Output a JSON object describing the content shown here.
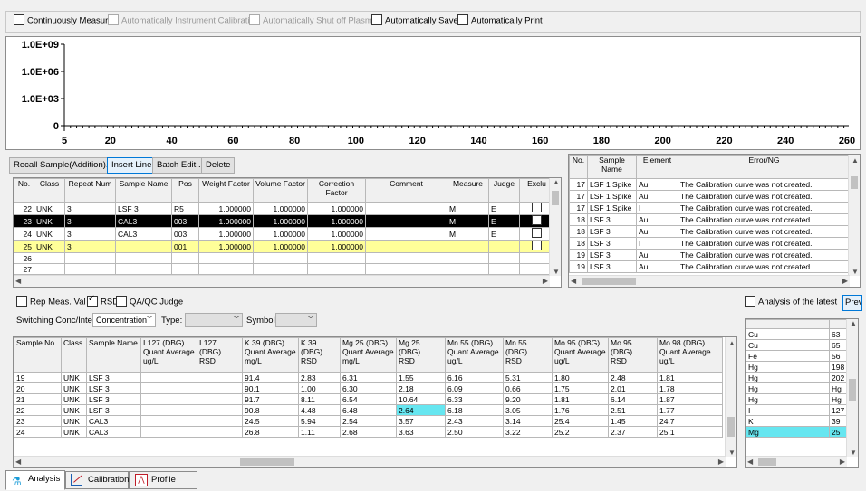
{
  "options": {
    "continuously_measure": "Continuously Measure",
    "auto_calibration": "Automatically Instrument Calibration",
    "auto_shutoff": "Automatically Shut off Plasma",
    "auto_save": "Automatically Save",
    "auto_print": "Automatically Print"
  },
  "graph": {
    "y_ticks": [
      "1.0E+09",
      "1.0E+06",
      "1.0E+03",
      "0"
    ],
    "x_ticks": [
      "5",
      "20",
      "40",
      "60",
      "80",
      "100",
      "120",
      "140",
      "160",
      "180",
      "200",
      "220",
      "240",
      "260"
    ]
  },
  "toolbar": {
    "recall": "Recall Sample(Addition)...",
    "insert": "Insert Line",
    "batch": "Batch Edit...",
    "delete": "Delete"
  },
  "sample_table": {
    "headers": [
      "No.",
      "Class",
      "Repeat Num",
      "Sample Name",
      "Pos",
      "Weight Factor",
      "Volume Factor",
      "Correction Factor",
      "Comment",
      "Measure",
      "Judge",
      "Exclu"
    ],
    "rows": [
      [
        "22",
        "UNK",
        "3",
        "LSF 3",
        "R5",
        "1.000000",
        "1.000000",
        "1.000000",
        "",
        "M",
        "E"
      ],
      [
        "23",
        "UNK",
        "3",
        "CAL3",
        "003",
        "1.000000",
        "1.000000",
        "1.000000",
        "",
        "M",
        "E"
      ],
      [
        "24",
        "UNK",
        "3",
        "CAL3",
        "003",
        "1.000000",
        "1.000000",
        "1.000000",
        "",
        "M",
        "E"
      ],
      [
        "25",
        "UNK",
        "3",
        "",
        "001",
        "1.000000",
        "1.000000",
        "1.000000",
        "",
        "",
        ""
      ],
      [
        "26",
        "",
        "",
        "",
        "",
        "",
        "",
        "",
        "",
        "",
        ""
      ],
      [
        "27",
        "",
        "",
        "",
        "",
        "",
        "",
        "",
        "",
        "",
        ""
      ]
    ]
  },
  "error_table": {
    "headers": [
      "No.",
      "Sample Name",
      "Element",
      "Error/NG"
    ],
    "rows": [
      [
        "17",
        "LSF 1 Spike",
        "Au",
        "The Calibration curve was not created."
      ],
      [
        "17",
        "LSF 1 Spike",
        "Au",
        "The Calibration curve was not created."
      ],
      [
        "17",
        "LSF 1 Spike",
        "I",
        "The Calibration curve was not created."
      ],
      [
        "18",
        "LSF 3",
        "Au",
        "The Calibration curve was not created."
      ],
      [
        "18",
        "LSF 3",
        "Au",
        "The Calibration curve was not created."
      ],
      [
        "18",
        "LSF 3",
        "I",
        "The Calibration curve was not created."
      ],
      [
        "19",
        "LSF 3",
        "Au",
        "The Calibration curve was not created."
      ],
      [
        "19",
        "LSF 3",
        "Au",
        "The Calibration curve was not created."
      ]
    ]
  },
  "view_options": {
    "rep_meas": "Rep Meas. Val",
    "rsd": "RSD",
    "qaqc": "QA/QC Judge",
    "switching_label": "Switching Conc/Inten:",
    "switching_value": "Concentration",
    "type_label": "Type:",
    "symbol_label": "Symbol:"
  },
  "results_table": {
    "headers": [
      "Sample No.",
      "Class",
      "Sample Name",
      "I 127 (DBG)\nQuant Average\nug/L",
      "I 127 (DBG)\nRSD",
      "K 39 (DBG)\nQuant Average\nmg/L",
      "K 39 (DBG)\nRSD",
      "Mg 25 (DBG)\nQuant Average\nmg/L",
      "Mg 25 (DBG)\nRSD",
      "Mn 55 (DBG)\nQuant Average\nug/L",
      "Mn 55 (DBG)\nRSD",
      "Mo 95 (DBG)\nQuant Average\nug/L",
      "Mo 95 (DBG)\nRSD",
      "Mo 98 (DBG)\nQuant Average\nug/L"
    ],
    "rows": [
      [
        "19",
        "UNK",
        "LSF 3",
        "",
        "",
        "91.4",
        "2.83",
        "6.31",
        "1.55",
        "6.16",
        "5.31",
        "1.80",
        "2.48",
        "1.81"
      ],
      [
        "20",
        "UNK",
        "LSF 3",
        "",
        "",
        "90.1",
        "1.00",
        "6.30",
        "2.18",
        "6.09",
        "0.66",
        "1.75",
        "2.01",
        "1.78"
      ],
      [
        "21",
        "UNK",
        "LSF 3",
        "",
        "",
        "91.7",
        "8.11",
        "6.54",
        "10.64",
        "6.33",
        "9.20",
        "1.81",
        "6.14",
        "1.87"
      ],
      [
        "22",
        "UNK",
        "LSF 3",
        "",
        "",
        "90.8",
        "4.48",
        "6.48",
        "2.64",
        "6.18",
        "3.05",
        "1.76",
        "2.51",
        "1.77"
      ],
      [
        "23",
        "UNK",
        "CAL3",
        "",
        "",
        "24.5",
        "5.94",
        "2.54",
        "3.57",
        "2.43",
        "3.14",
        "25.4",
        "1.45",
        "24.7"
      ],
      [
        "24",
        "UNK",
        "CAL3",
        "",
        "",
        "26.8",
        "1.11",
        "2.68",
        "3.63",
        "2.50",
        "3.22",
        "25.2",
        "2.37",
        "25.1"
      ]
    ]
  },
  "latest": {
    "label": "Analysis of the latest",
    "button": "Prev",
    "rows": [
      [
        "Cu",
        "63"
      ],
      [
        "Cu",
        "65"
      ],
      [
        "Fe",
        "56"
      ],
      [
        "Hg",
        "198"
      ],
      [
        "Hg",
        "202"
      ],
      [
        "Hg",
        "Hg"
      ],
      [
        "Hg",
        "Hg"
      ],
      [
        "I",
        "127"
      ],
      [
        "K",
        "39"
      ],
      [
        "Mg",
        "25"
      ]
    ]
  },
  "tabs": [
    "Analysis",
    "Calibration ...",
    "Profile"
  ],
  "colors": {
    "selected_row": "#000000",
    "edit_row": "#ffff99",
    "highlight_cell": "#66e6f0"
  }
}
